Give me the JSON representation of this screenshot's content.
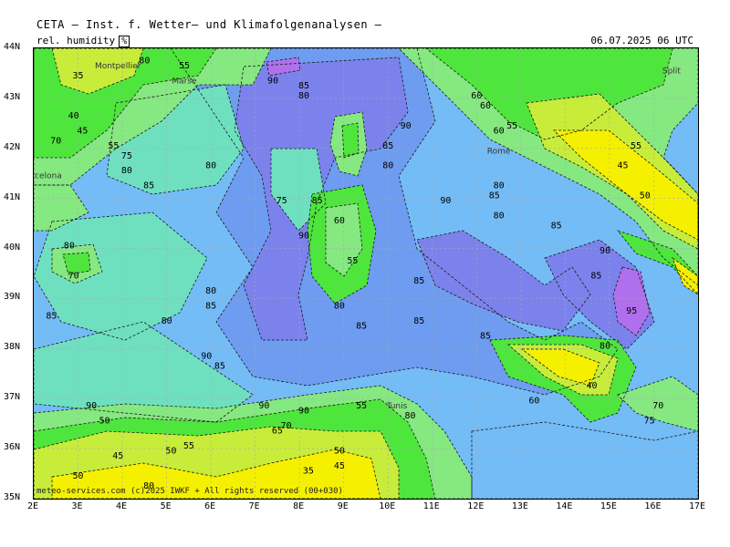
{
  "header": {
    "title": "CETA – Inst. f. Wetter– und Klimafolgenanalysen –",
    "variable": "rel. humidity",
    "unit": "%",
    "datetime": "06.07.2025 06 UTC"
  },
  "footer": {
    "copyright": "meteo-services.com (c)2025 IWKF + All rights reserved (00+030)"
  },
  "axes": {
    "lat_labels": [
      "44N",
      "43N",
      "42N",
      "41N",
      "40N",
      "39N",
      "38N",
      "37N",
      "36N",
      "35N"
    ],
    "lon_labels": [
      "2E",
      "3E",
      "4E",
      "5E",
      "6E",
      "7E",
      "8E",
      "9E",
      "10E",
      "11E",
      "12E",
      "13E",
      "14E",
      "15E",
      "16E",
      "17E"
    ]
  },
  "places": [
    {
      "name": "Montpellier",
      "lon": 3.9,
      "lat": 43.6
    },
    {
      "name": "Marse",
      "lon": 5.4,
      "lat": 43.3
    },
    {
      "name": "Split",
      "lon": 16.4,
      "lat": 43.5
    },
    {
      "name": "Barcelona",
      "lon": 2.17,
      "lat": 41.4
    },
    {
      "name": "Rome",
      "lon": 12.5,
      "lat": 41.9
    },
    {
      "name": "Tunis",
      "lon": 10.2,
      "lat": 36.8
    }
  ],
  "contour_labels": [
    {
      "t": "80",
      "lon": 4.5,
      "lat": 43.7
    },
    {
      "t": "55",
      "lon": 5.4,
      "lat": 43.6
    },
    {
      "t": "35",
      "lon": 3.0,
      "lat": 43.4
    },
    {
      "t": "90",
      "lon": 7.4,
      "lat": 43.3
    },
    {
      "t": "85",
      "lon": 8.1,
      "lat": 43.2
    },
    {
      "t": "80",
      "lon": 8.1,
      "lat": 43.0
    },
    {
      "t": "40",
      "lon": 2.9,
      "lat": 42.6
    },
    {
      "t": "45",
      "lon": 3.1,
      "lat": 42.3
    },
    {
      "t": "70",
      "lon": 2.5,
      "lat": 42.1
    },
    {
      "t": "55",
      "lon": 3.8,
      "lat": 42.0
    },
    {
      "t": "75",
      "lon": 4.1,
      "lat": 41.8
    },
    {
      "t": "80",
      "lon": 4.1,
      "lat": 41.5
    },
    {
      "t": "80",
      "lon": 6.0,
      "lat": 41.6
    },
    {
      "t": "85",
      "lon": 4.6,
      "lat": 41.2
    },
    {
      "t": "75",
      "lon": 7.6,
      "lat": 40.9
    },
    {
      "t": "85",
      "lon": 8.4,
      "lat": 40.9
    },
    {
      "t": "90",
      "lon": 8.1,
      "lat": 40.2
    },
    {
      "t": "60",
      "lon": 8.9,
      "lat": 40.5
    },
    {
      "t": "55",
      "lon": 9.2,
      "lat": 39.7
    },
    {
      "t": "80",
      "lon": 8.9,
      "lat": 38.8
    },
    {
      "t": "85",
      "lon": 9.4,
      "lat": 38.4
    },
    {
      "t": "85",
      "lon": 10.0,
      "lat": 42.0
    },
    {
      "t": "80",
      "lon": 10.0,
      "lat": 41.6
    },
    {
      "t": "90",
      "lon": 10.4,
      "lat": 42.4
    },
    {
      "t": "90",
      "lon": 11.3,
      "lat": 40.9
    },
    {
      "t": "80",
      "lon": 2.8,
      "lat": 40.0
    },
    {
      "t": "70",
      "lon": 2.9,
      "lat": 39.4
    },
    {
      "t": "80",
      "lon": 6.0,
      "lat": 39.1
    },
    {
      "t": "85",
      "lon": 6.0,
      "lat": 38.8
    },
    {
      "t": "85",
      "lon": 2.4,
      "lat": 38.6
    },
    {
      "t": "80",
      "lon": 5.0,
      "lat": 38.5
    },
    {
      "t": "90",
      "lon": 5.9,
      "lat": 37.8
    },
    {
      "t": "85",
      "lon": 6.2,
      "lat": 37.6
    },
    {
      "t": "85",
      "lon": 10.7,
      "lat": 39.3
    },
    {
      "t": "85",
      "lon": 10.7,
      "lat": 38.5
    },
    {
      "t": "85",
      "lon": 12.2,
      "lat": 38.2
    },
    {
      "t": "60",
      "lon": 12.0,
      "lat": 43.0
    },
    {
      "t": "60",
      "lon": 12.2,
      "lat": 42.8
    },
    {
      "t": "55",
      "lon": 12.8,
      "lat": 42.4
    },
    {
      "t": "60",
      "lon": 12.5,
      "lat": 42.3
    },
    {
      "t": "80",
      "lon": 12.5,
      "lat": 41.2
    },
    {
      "t": "80",
      "lon": 12.5,
      "lat": 40.6
    },
    {
      "t": "85",
      "lon": 13.8,
      "lat": 40.4
    },
    {
      "t": "85",
      "lon": 14.7,
      "lat": 39.4
    },
    {
      "t": "90",
      "lon": 14.9,
      "lat": 39.9
    },
    {
      "t": "95",
      "lon": 15.5,
      "lat": 38.7
    },
    {
      "t": "55",
      "lon": 15.6,
      "lat": 42.0
    },
    {
      "t": "45",
      "lon": 15.3,
      "lat": 41.6
    },
    {
      "t": "50",
      "lon": 15.8,
      "lat": 41.0
    },
    {
      "t": "40",
      "lon": 14.6,
      "lat": 37.2
    },
    {
      "t": "70",
      "lon": 16.1,
      "lat": 36.8
    },
    {
      "t": "75",
      "lon": 15.9,
      "lat": 36.5
    },
    {
      "t": "60",
      "lon": 13.3,
      "lat": 36.9
    },
    {
      "t": "80",
      "lon": 14.9,
      "lat": 38.0
    },
    {
      "t": "90",
      "lon": 3.3,
      "lat": 36.8
    },
    {
      "t": "50",
      "lon": 3.6,
      "lat": 36.5
    },
    {
      "t": "55",
      "lon": 5.5,
      "lat": 36.0
    },
    {
      "t": "50",
      "lon": 5.1,
      "lat": 35.9
    },
    {
      "t": "45",
      "lon": 3.9,
      "lat": 35.8
    },
    {
      "t": "50",
      "lon": 3.0,
      "lat": 35.4
    },
    {
      "t": "80",
      "lon": 4.6,
      "lat": 35.2
    },
    {
      "t": "90",
      "lon": 7.2,
      "lat": 36.8
    },
    {
      "t": "70",
      "lon": 7.7,
      "lat": 36.4
    },
    {
      "t": "65",
      "lon": 7.5,
      "lat": 36.3
    },
    {
      "t": "90",
      "lon": 8.1,
      "lat": 36.7
    },
    {
      "t": "55",
      "lon": 9.4,
      "lat": 36.8
    },
    {
      "t": "80",
      "lon": 10.5,
      "lat": 36.6
    },
    {
      "t": "35",
      "lon": 8.2,
      "lat": 35.5
    },
    {
      "t": "45",
      "lon": 8.9,
      "lat": 35.6
    },
    {
      "t": "50",
      "lon": 8.9,
      "lat": 35.9
    },
    {
      "t": "85",
      "lon": 12.4,
      "lat": 41.0
    }
  ],
  "legend_colors": {
    "land_dry": "#f5f000",
    "yellow_green": "#c8ec3a",
    "green": "#4ee63c",
    "light_green": "#86e880",
    "teal": "#6ee0c0",
    "light_blue": "#74bcf6",
    "blue": "#6e9cf0",
    "violet_blue": "#7c82ec",
    "purple": "#b070ee"
  }
}
